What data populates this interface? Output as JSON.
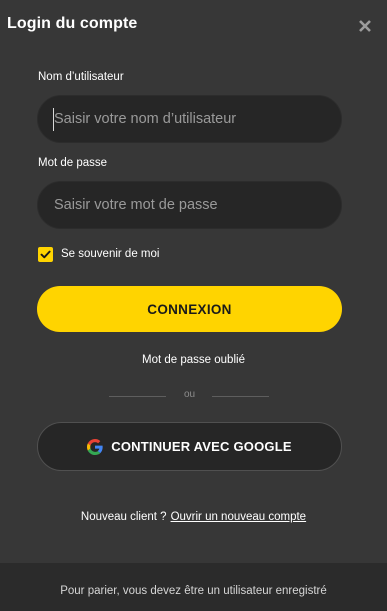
{
  "header": {
    "title": "Login du compte",
    "close_icon": "close-icon"
  },
  "form": {
    "username_label": "Nom d’utilisateur",
    "username_placeholder": "Saisir votre nom d’utilisateur",
    "username_value": "",
    "password_label": "Mot de passe",
    "password_placeholder": "Saisir votre mot de passe",
    "password_value": "",
    "remember_label": "Se souvenir de moi",
    "remember_checked": true,
    "login_button": "CONNEXION",
    "forgot_link": "Mot de passe oublié",
    "divider_text": "ou",
    "google_button": "CONTINUER AVEC GOOGLE",
    "google_icon": "google-icon"
  },
  "signup": {
    "prompt": "Nouveau client ?",
    "link": "Ouvrir un nouveau compte"
  },
  "footer": {
    "text": "Pour parier, vous devez être un utilisateur enregistré"
  },
  "colors": {
    "background": "#373737",
    "input_background": "#262626",
    "accent": "#ffd400",
    "footer_background": "#2b2b2b"
  }
}
